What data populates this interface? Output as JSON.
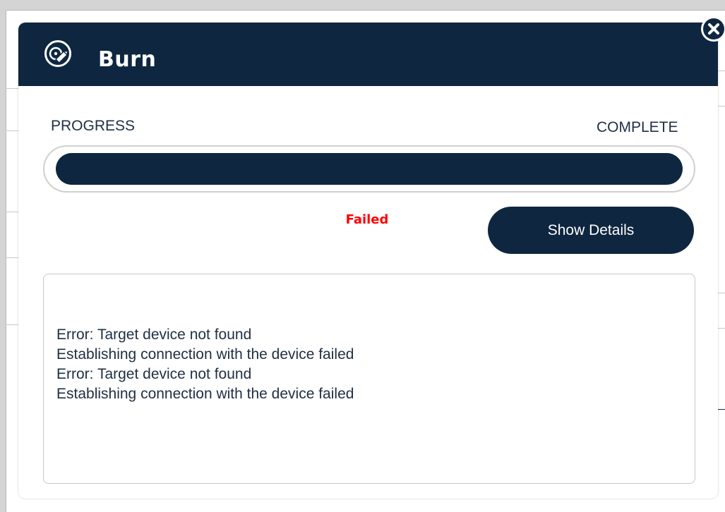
{
  "dialog": {
    "title": "Burn",
    "title_icon": "disc-edit-icon",
    "close_icon": "close-icon"
  },
  "progress": {
    "left_label": "PROGRESS",
    "right_label": "COMPLETE",
    "fraction": 1.0,
    "status_text": "Failed"
  },
  "actions": {
    "show_details_label": "Show Details"
  },
  "log": {
    "lines": [
      "Error: Target device not found",
      "Establishing connection with the device failed",
      "Error: Target device not found",
      "Establishing connection with the device failed"
    ]
  },
  "colors": {
    "header_bg": "#0f2640",
    "accent": "#0f2640",
    "status_error": "#ff0000",
    "text": "#1f2f44"
  }
}
